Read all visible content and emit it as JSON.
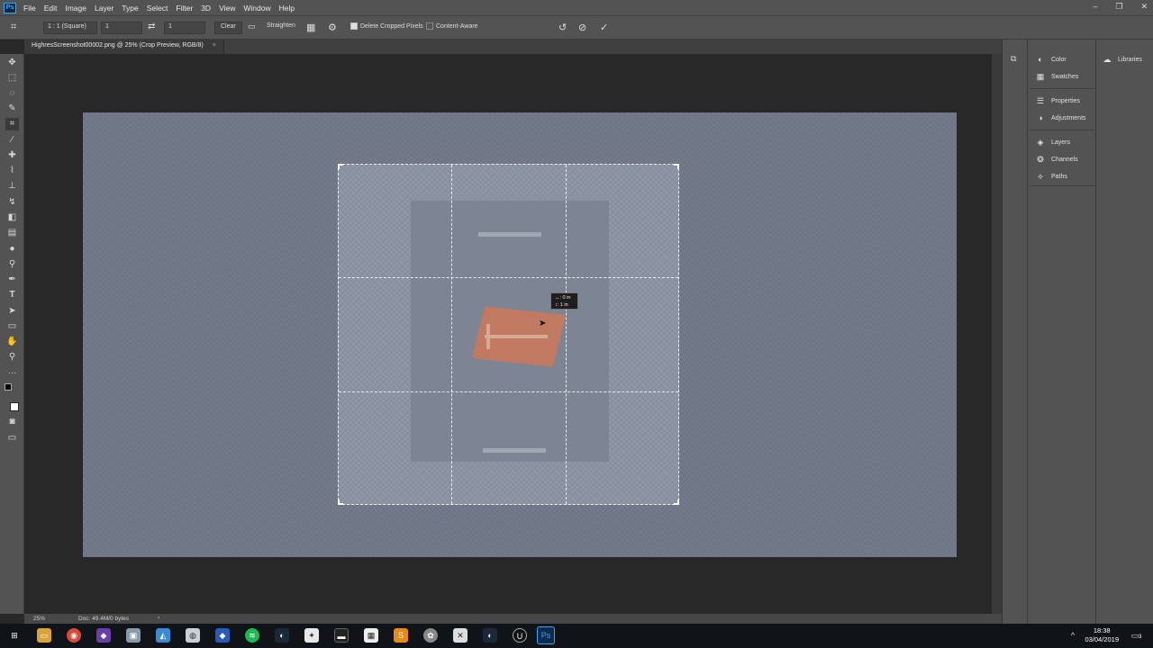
{
  "app": {
    "logo_text": "Ps"
  },
  "menu": [
    "File",
    "Edit",
    "Image",
    "Layer",
    "Type",
    "Select",
    "Filter",
    "3D",
    "View",
    "Window",
    "Help"
  ],
  "window_controls": {
    "minimize": "–",
    "restore": "❐",
    "close": "✕"
  },
  "options": {
    "ratio_preset": "1 : 1 (Square)",
    "width_value": "1",
    "height_value": "1",
    "clear_label": "Clear",
    "straighten_label": "Straighten",
    "delete_cropped_label": "Delete Cropped Pixels",
    "delete_cropped_checked": true,
    "content_aware_label": "Content-Aware",
    "content_aware_checked": false
  },
  "document": {
    "tab_title": "HighresScreenshot00002.png @ 25% (Crop Preview, RGB/8)",
    "tab_close": "×"
  },
  "tooltip": {
    "line1": "↔: 0 in",
    "line2": "↕: 1 in"
  },
  "status": {
    "zoom": "25%",
    "doc_info": "Doc: 49.4M/0 bytes",
    "arrow": "›"
  },
  "panels": {
    "group1": [
      {
        "icon": "color-icon",
        "label": "Color"
      },
      {
        "icon": "swatches-icon",
        "label": "Swatches"
      }
    ],
    "group2": [
      {
        "icon": "properties-icon",
        "label": "Properties"
      },
      {
        "icon": "adjustments-icon",
        "label": "Adjustments"
      }
    ],
    "group3": [
      {
        "icon": "layers-icon",
        "label": "Layers"
      },
      {
        "icon": "channels-icon",
        "label": "Channels"
      },
      {
        "icon": "paths-icon",
        "label": "Paths"
      }
    ],
    "libraries_label": "Libraries"
  },
  "taskbar": {
    "time": "18:38",
    "date": "03/04/2019",
    "notifications": "3"
  },
  "colors": {
    "accent": "#31a8ff",
    "chrome": "#535353",
    "canvas_bg": "#282828",
    "image_fill": "#6e7585",
    "asset": "#c07a62"
  }
}
